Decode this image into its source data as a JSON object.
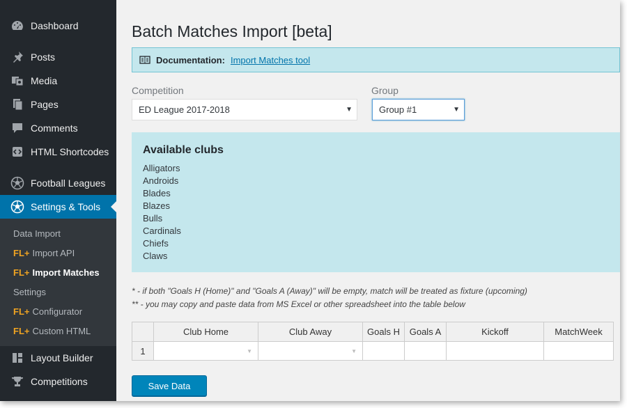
{
  "sidebar": {
    "items": [
      {
        "label": "Dashboard",
        "icon": "dashboard-icon"
      },
      {
        "label": "Posts",
        "icon": "pin-icon"
      },
      {
        "label": "Media",
        "icon": "media-icon"
      },
      {
        "label": "Pages",
        "icon": "pages-icon"
      },
      {
        "label": "Comments",
        "icon": "comment-icon"
      },
      {
        "label": "HTML Shortcodes",
        "icon": "code-icon"
      },
      {
        "label": "Football Leagues",
        "icon": "football-icon"
      },
      {
        "label": "Settings & Tools",
        "icon": "football-icon"
      },
      {
        "label": "Layout Builder",
        "icon": "layout-icon"
      },
      {
        "label": "Competitions",
        "icon": "trophy-icon"
      }
    ],
    "submenu": {
      "data_import": "Data Import",
      "import_api": "Import API",
      "import_matches": "Import Matches",
      "settings": "Settings",
      "configurator": "Configurator",
      "custom_html": "Custom HTML",
      "fl_prefix": "FL+"
    }
  },
  "page": {
    "title": "Batch Matches Import [beta]",
    "doc_label": "Documentation:",
    "doc_link": "Import Matches tool",
    "competition_label": "Competition",
    "competition_value": "ED League 2017-2018",
    "group_label": "Group",
    "group_value": "Group #1",
    "clubs_title": "Available clubs",
    "clubs": [
      "Alligators",
      "Androids",
      "Blades",
      "Blazes",
      "Bulls",
      "Cardinals",
      "Chiefs",
      "Claws"
    ],
    "note1": "* - if both \"Goals H (Home)\" and \"Goals A (Away)\" will be empty, match will be treated as fixture (upcoming)",
    "note2": "** - you may copy and paste data from MS Excel or other spreadsheet into the table below",
    "table_headers": [
      "Club Home",
      "Club Away",
      "Goals H",
      "Goals A",
      "Kickoff",
      "MatchWeek"
    ],
    "row_number": "1",
    "save_label": "Save Data"
  },
  "colors": {
    "sidebar_bg": "#23282d",
    "active_bg": "#0073aa",
    "info_bg": "#c4e7ed",
    "button_bg": "#0085ba",
    "fl_accent": "#f0a422"
  }
}
